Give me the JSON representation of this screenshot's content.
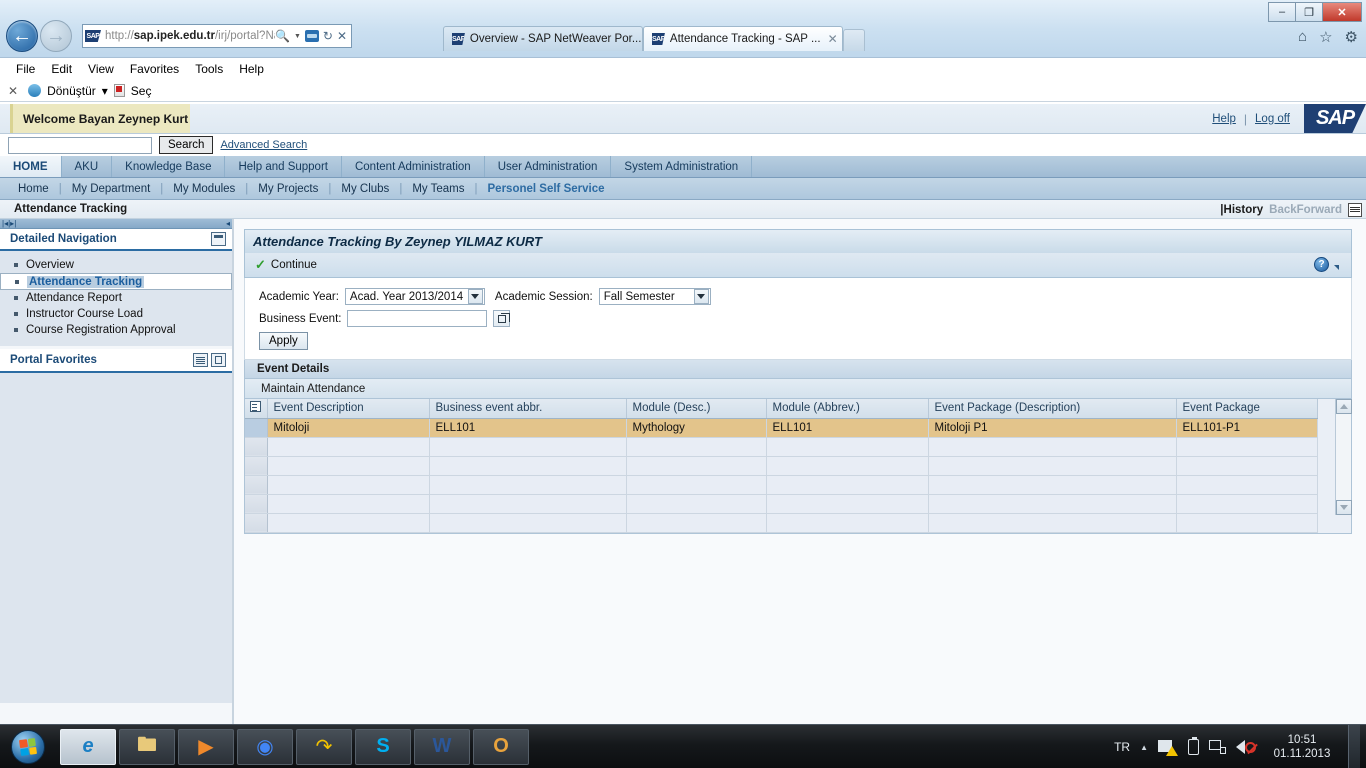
{
  "browser": {
    "url_prefix": "http://",
    "url_bold": "sap.ipek.edu.tr",
    "url_suffix": "/irj/portal?NavigationTarge",
    "back_icon": "back-arrow-icon",
    "forward_icon": "forward-arrow-icon",
    "search_icon": "magnifier-icon",
    "refresh_icon": "refresh-icon",
    "stop_icon": "stop-x-icon",
    "home_icon": "home-icon",
    "favorites_icon": "star-icon",
    "tools_icon": "gear-icon",
    "minimize_label": "–",
    "restore_label": "❐",
    "close_label": "✕",
    "tabs": [
      {
        "title": "Overview - SAP NetWeaver Por...",
        "active": false
      },
      {
        "title": "Attendance Tracking - SAP ...",
        "active": true
      }
    ],
    "menu": [
      "File",
      "Edit",
      "View",
      "Favorites",
      "Tools",
      "Help"
    ],
    "command_bar": {
      "close": "✕",
      "convert": "Dönüştür",
      "dropdown": "▾",
      "select": "Seç"
    }
  },
  "portal": {
    "welcome": "Welcome Bayan Zeynep Kurt",
    "help_link": "Help",
    "logoff_link": "Log off",
    "brand": "SAP",
    "search": {
      "value": "",
      "placeholder": "",
      "button": "Search",
      "advanced": "Advanced Search"
    },
    "tabs_level1": [
      {
        "label": "HOME",
        "active": true
      },
      {
        "label": "AKU",
        "active": false
      },
      {
        "label": "Knowledge Base",
        "active": false
      },
      {
        "label": "Help and Support",
        "active": false
      },
      {
        "label": "Content Administration",
        "active": false
      },
      {
        "label": "User Administration",
        "active": false
      },
      {
        "label": "System Administration",
        "active": false
      }
    ],
    "tabs_level2": [
      {
        "label": "Home",
        "current": false
      },
      {
        "label": "My Department",
        "current": false
      },
      {
        "label": "My Modules",
        "current": false
      },
      {
        "label": "My Projects",
        "current": false
      },
      {
        "label": "My Clubs",
        "current": false
      },
      {
        "label": "My Teams",
        "current": false
      },
      {
        "label": "Personel Self Service",
        "current": true
      }
    ],
    "page_header": "Attendance Tracking",
    "history_label": "|History",
    "back_forward_label": "BackForward"
  },
  "sidebar": {
    "detailed_navigation_title": "Detailed Navigation",
    "collapse_icon": "minimize-icon",
    "items": [
      {
        "label": "Overview",
        "selected": false
      },
      {
        "label": "Attendance Tracking",
        "selected": true
      },
      {
        "label": "Attendance Report",
        "selected": false
      },
      {
        "label": "Instructor Course Load",
        "selected": false
      },
      {
        "label": "Course Registration Approval",
        "selected": false
      }
    ],
    "portal_favorites_title": "Portal Favorites"
  },
  "app": {
    "title": "Attendance Tracking By Zeynep YILMAZ KURT",
    "continue_label": "Continue",
    "continue_icon": "green-check-icon",
    "help_icon": "question-help-icon",
    "form": {
      "academic_year_label": "Academic Year:",
      "academic_year_value": "Acad. Year 2013/2014",
      "academic_session_label": "Academic Session:",
      "academic_session_value": "Fall Semester",
      "business_event_label": "Business Event:",
      "business_event_value": "",
      "business_event_picker_icon": "value-help-icon",
      "apply_label": "Apply"
    },
    "panel_title": "Event Details",
    "panel_subtitle": "Maintain Attendance",
    "table": {
      "select_all_icon": "table-settings-icon",
      "columns": [
        "Event Description",
        "Business event abbr.",
        "Module (Desc.)",
        "Module (Abbrev.)",
        "Event Package (Description)",
        "Event Package"
      ],
      "rows": [
        {
          "selected": true,
          "cells": [
            "Mitoloji",
            "ELL101",
            "Mythology",
            "ELL101",
            "Mitoloji P1",
            "ELL101-P1"
          ]
        },
        {
          "selected": false,
          "cells": [
            "",
            "",
            "",
            "",
            "",
            ""
          ]
        },
        {
          "selected": false,
          "cells": [
            "",
            "",
            "",
            "",
            "",
            ""
          ]
        },
        {
          "selected": false,
          "cells": [
            "",
            "",
            "",
            "",
            "",
            ""
          ]
        },
        {
          "selected": false,
          "cells": [
            "",
            "",
            "",
            "",
            "",
            ""
          ]
        },
        {
          "selected": false,
          "cells": [
            "",
            "",
            "",
            "",
            "",
            ""
          ]
        }
      ],
      "scroll_up_icon": "scroll-up-arrow",
      "scroll_down_icon": "scroll-down-arrow"
    }
  },
  "taskbar": {
    "start_label": "start-orb",
    "items": [
      {
        "name": "internet-explorer",
        "glyph": "e",
        "active": true
      },
      {
        "name": "file-explorer",
        "glyph": "🖿",
        "active": false
      },
      {
        "name": "media-player",
        "glyph": "▶",
        "active": false
      },
      {
        "name": "google-chrome",
        "glyph": "◉",
        "active": false
      },
      {
        "name": "app-yellow-arrow",
        "glyph": "↷",
        "active": false
      },
      {
        "name": "skype",
        "glyph": "S",
        "active": false
      },
      {
        "name": "microsoft-word",
        "glyph": "W",
        "active": false
      },
      {
        "name": "microsoft-outlook",
        "glyph": "O",
        "active": false
      }
    ],
    "language": "TR",
    "time": "10:51",
    "date": "01.11.2013"
  }
}
